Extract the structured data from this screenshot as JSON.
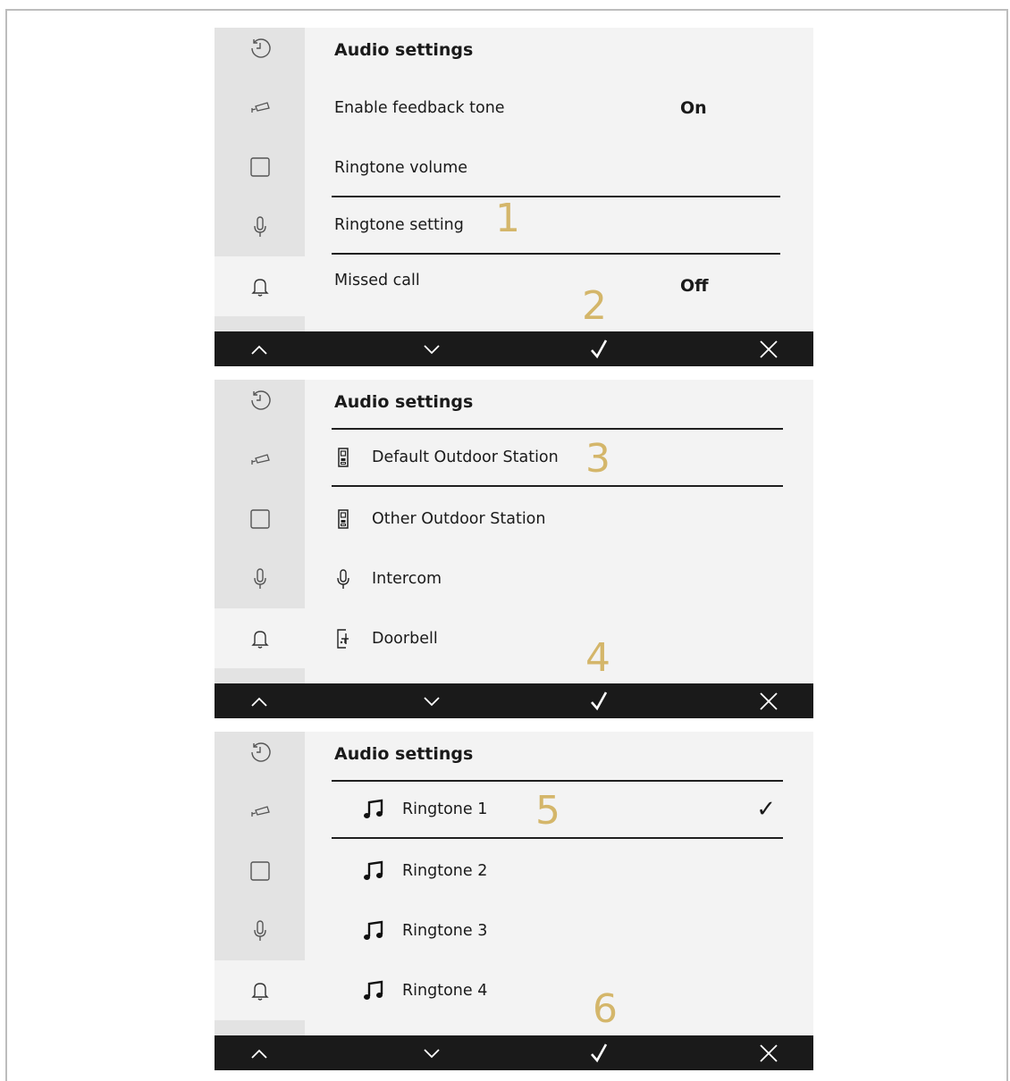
{
  "colors": {
    "accent_number": "#d4b66a",
    "sidebar": "#e3e3e3",
    "panel": "#f3f3f3",
    "bar": "#1a1a1a"
  },
  "sidebar_icons": [
    "history-icon",
    "camera-icon",
    "square-icon",
    "microphone-icon",
    "bell-icon"
  ],
  "bottom_bar_icons": [
    "chevron-up-icon",
    "chevron-down-icon",
    "check-icon",
    "close-icon"
  ],
  "panel1": {
    "title": "Audio settings",
    "rows": [
      {
        "label": "Enable feedback tone",
        "value": "On"
      },
      {
        "label": "Ringtone volume",
        "value": ""
      },
      {
        "label": "Ringtone setting",
        "value": ""
      },
      {
        "label": "Missed call",
        "value": "Off"
      }
    ],
    "step_a": "1",
    "step_b": "2"
  },
  "panel2": {
    "title": "Audio settings",
    "rows": [
      {
        "label": "Default Outdoor Station",
        "icon": "outdoor-station-icon"
      },
      {
        "label": "Other Outdoor Station",
        "icon": "outdoor-station-icon"
      },
      {
        "label": "Intercom",
        "icon": "microphone-icon"
      },
      {
        "label": "Doorbell",
        "icon": "doorbell-icon"
      }
    ],
    "step_a": "3",
    "step_b": "4"
  },
  "panel3": {
    "title": "Audio settings",
    "rows": [
      {
        "label": "Ringtone 1",
        "icon": "music-note-icon",
        "checked": "✓"
      },
      {
        "label": "Ringtone 2",
        "icon": "music-note-icon"
      },
      {
        "label": "Ringtone 3",
        "icon": "music-note-icon"
      },
      {
        "label": "Ringtone 4",
        "icon": "music-note-icon"
      }
    ],
    "step_a": "5",
    "step_b": "6"
  }
}
